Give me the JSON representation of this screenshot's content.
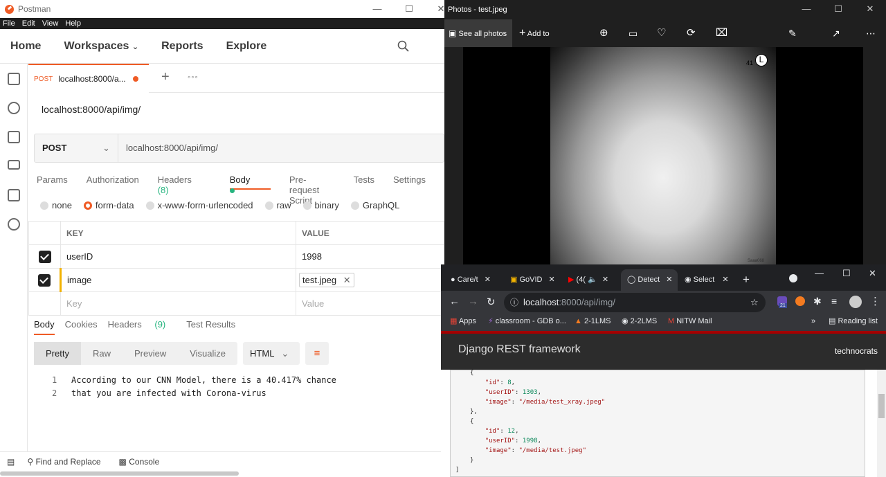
{
  "postman": {
    "title": "Postman",
    "menu": [
      "File",
      "Edit",
      "View",
      "Help"
    ],
    "nav": [
      "Home",
      "Workspaces",
      "Reports",
      "Explore"
    ],
    "tab": {
      "method": "POST",
      "label": "localhost:8000/a..."
    },
    "url_title": "localhost:8000/api/img/",
    "request": {
      "method": "POST",
      "url": "localhost:8000/api/img/"
    },
    "req_tabs": [
      "Params",
      "Authorization",
      "Headers",
      "Body",
      "Pre-request Script",
      "Tests",
      "Settings"
    ],
    "headers_count": "(8)",
    "body_types": [
      "none",
      "form-data",
      "x-www-form-urlencoded",
      "raw",
      "binary",
      "GraphQL"
    ],
    "table": {
      "key_header": "KEY",
      "value_header": "VALUE",
      "rows": [
        {
          "key": "userID",
          "value": "1998"
        },
        {
          "key": "image",
          "value": "test.jpeg"
        }
      ],
      "key_placeholder": "Key",
      "value_placeholder": "Value"
    },
    "resp_tabs": [
      "Body",
      "Cookies",
      "Headers",
      "Test Results"
    ],
    "resp_headers_count": "(9)",
    "resp_views": [
      "Pretty",
      "Raw",
      "Preview",
      "Visualize"
    ],
    "resp_format": "HTML",
    "code_lines": [
      {
        "n": "1",
        "text": "According to our CNN Model, there is a 40.417% chance"
      },
      {
        "n": "2",
        "text": "that you are infected with Corona-virus"
      }
    ],
    "footer": [
      "Find and Replace",
      "Console"
    ]
  },
  "photos": {
    "title": "Photos - test.jpeg",
    "see_all": "See all photos",
    "add_to": "Add to",
    "xray_marker": "41",
    "xray_letter": "L",
    "xray_corner": "Saaa068"
  },
  "chrome": {
    "tabs": [
      "Care/t",
      "GoVID",
      "(4(",
      "Detect",
      "Select"
    ],
    "url_host": "localhost",
    "url_path": ":8000/api/img/",
    "ext_badge": "21",
    "bookmarks": [
      "Apps",
      "classroom - GDB o...",
      "2-1LMS",
      "2-2LMS",
      "NITW Mail"
    ],
    "reading_list": "Reading list",
    "drf_title": "Django REST framework",
    "drf_user": "technocrats",
    "json_lines": [
      "{",
      "    \"id\": 8,",
      "    \"userID\": 1303,",
      "    \"image\": \"/media/test_xray.jpeg\"",
      "},",
      "{",
      "    \"id\": 12,",
      "    \"userID\": 1998,",
      "    \"image\": \"/media/test.jpeg\"",
      "}",
      "]"
    ]
  }
}
